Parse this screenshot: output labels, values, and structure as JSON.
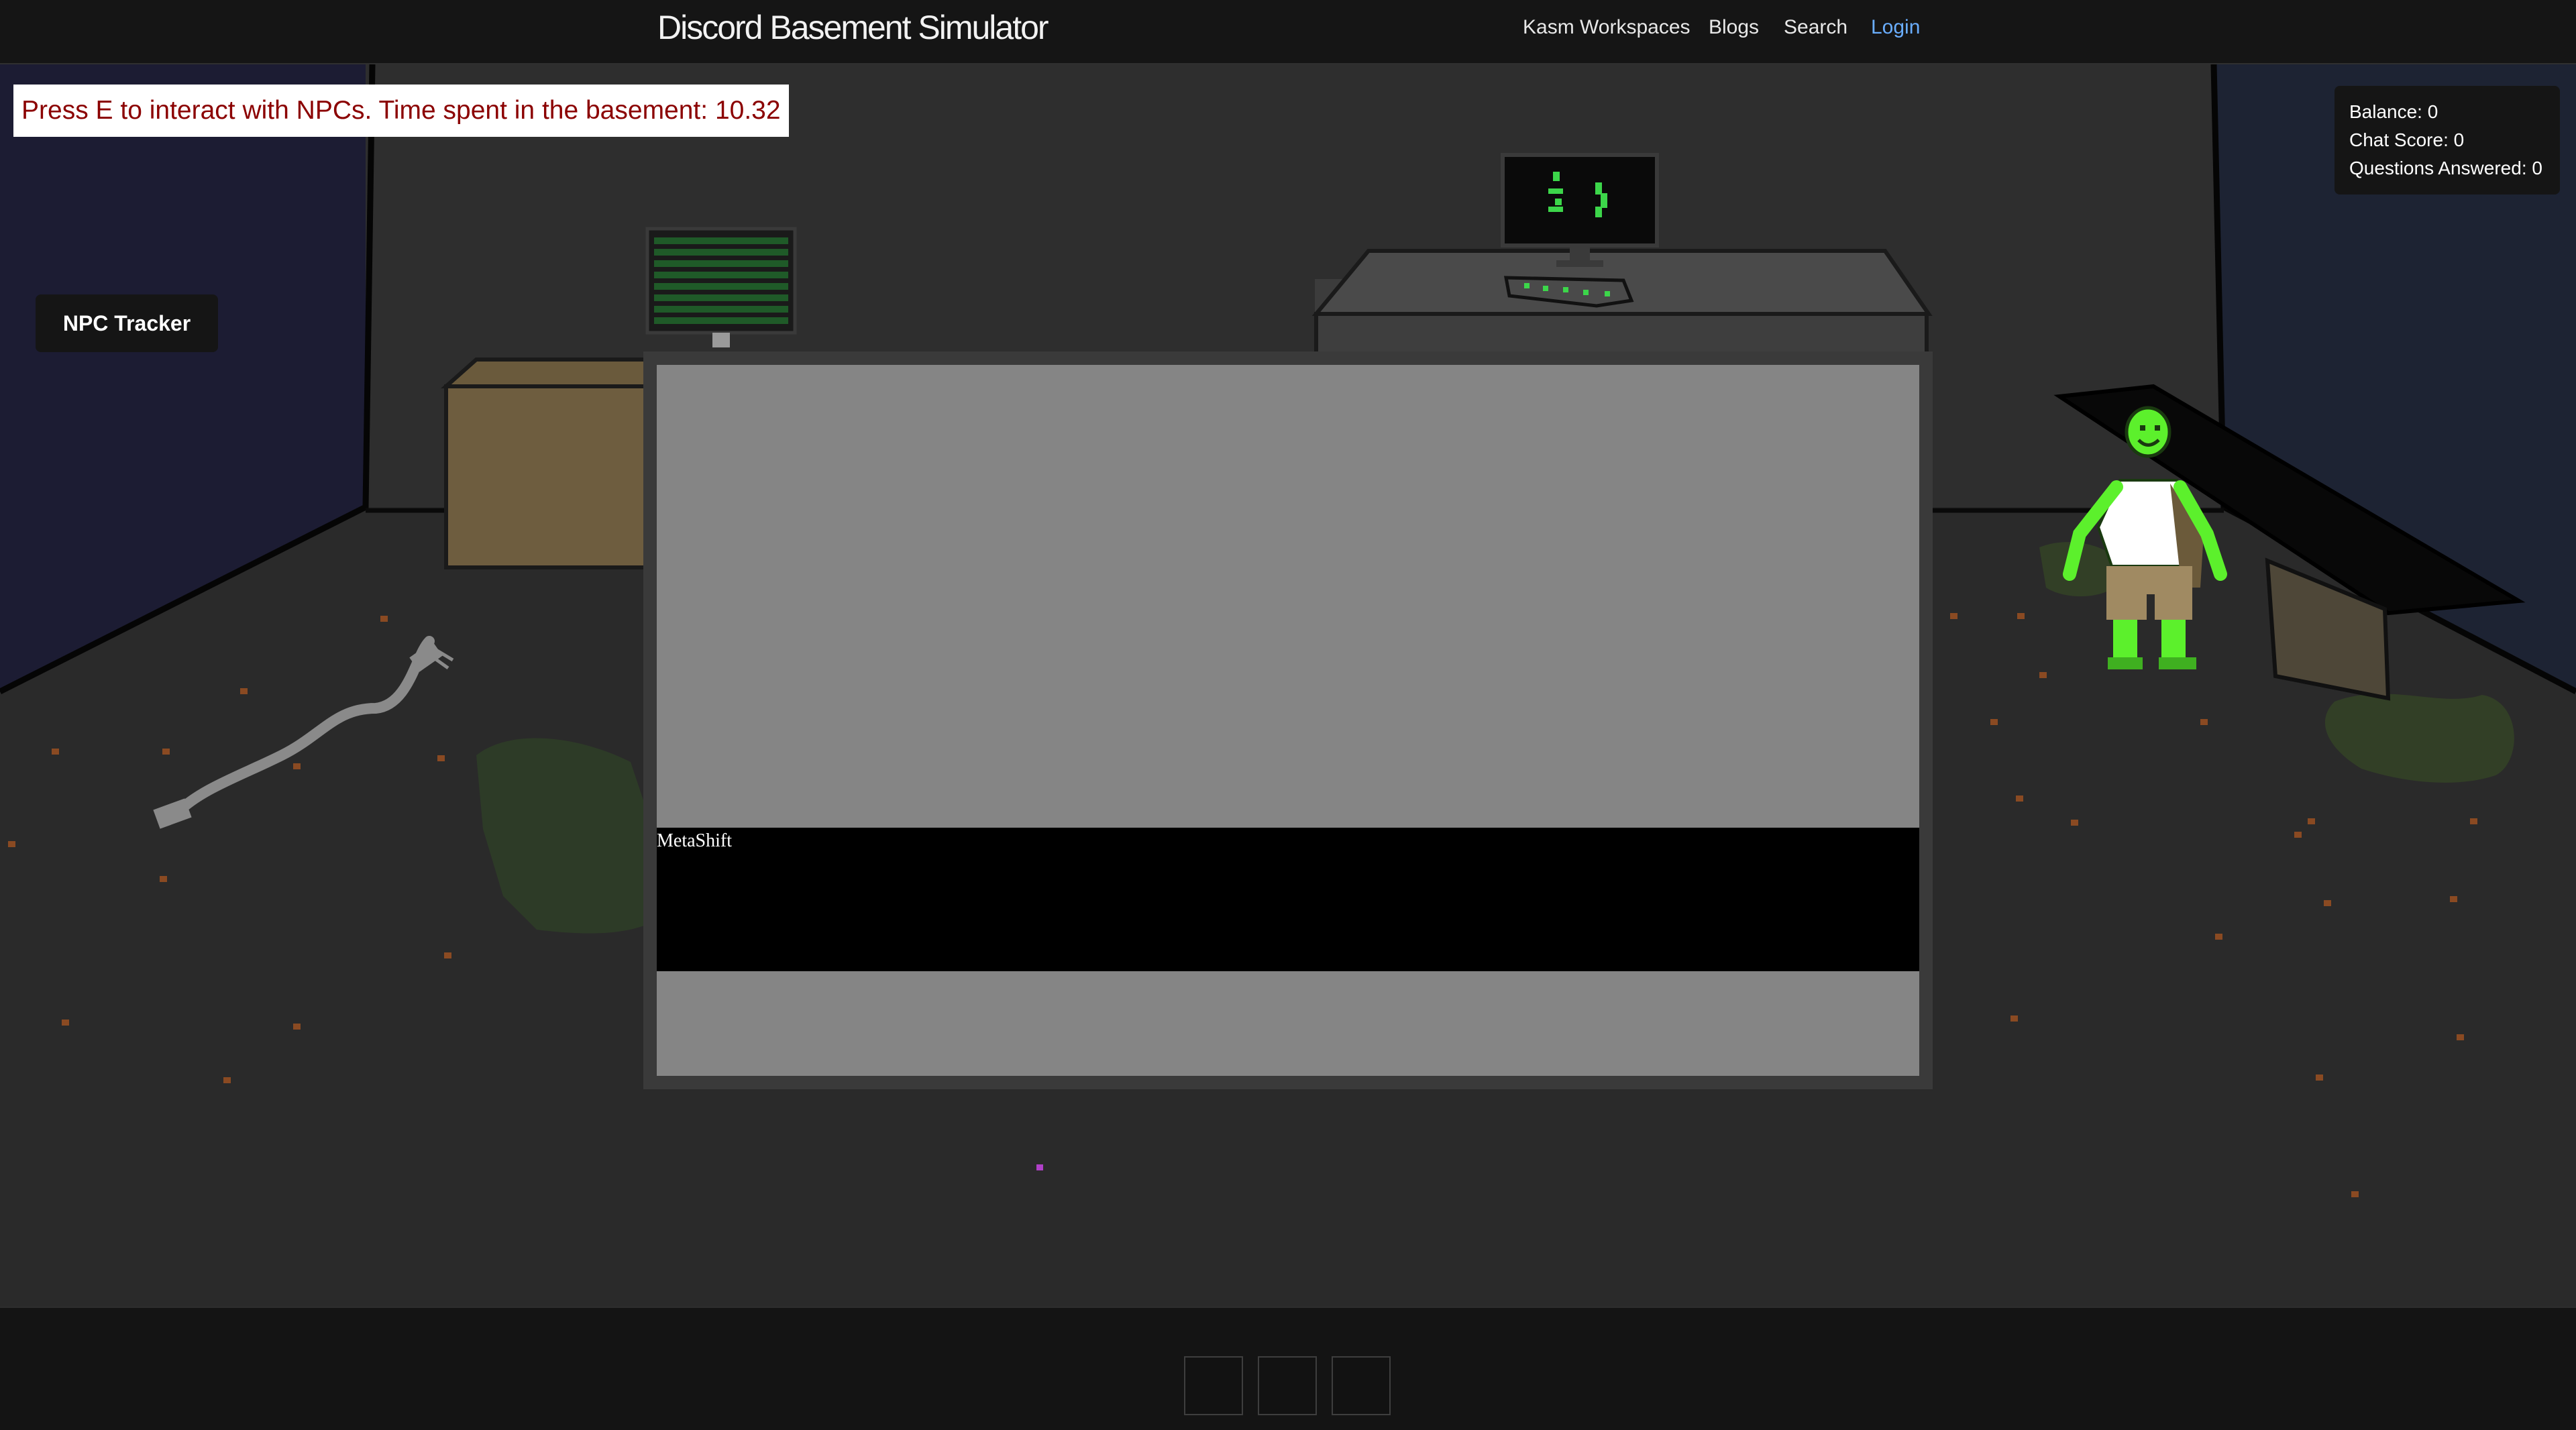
{
  "nav": {
    "title": "Discord Basement Simulator",
    "links": [
      "Kasm Workspaces",
      "Blogs",
      "Search",
      "Login"
    ]
  },
  "game": {
    "instruction_banner": "Press E to interact with NPCs. Time spent in the basement: 10.32",
    "npc_tracker_label": "NPC Tracker",
    "stats": {
      "balance": "Balance: 0",
      "chat_score": "Chat Score: 0",
      "questions_answered": "Questions Answered: 0"
    },
    "dialog": {
      "speaker": "MetaShift"
    }
  },
  "hotbar": {
    "slot_count": 3
  },
  "colors": {
    "banner_text": "#8b0000",
    "login_link": "#6aaeff",
    "npc_green": "#5cf02c",
    "crt_green": "#3cd64a"
  },
  "icons": [
    "power-cord-icon",
    "cardboard-box-icon",
    "server-rack-icon",
    "computer-monitor-icon",
    "keyboard-icon",
    "npc-character-icon",
    "bench-icon",
    "puddle-icon"
  ]
}
